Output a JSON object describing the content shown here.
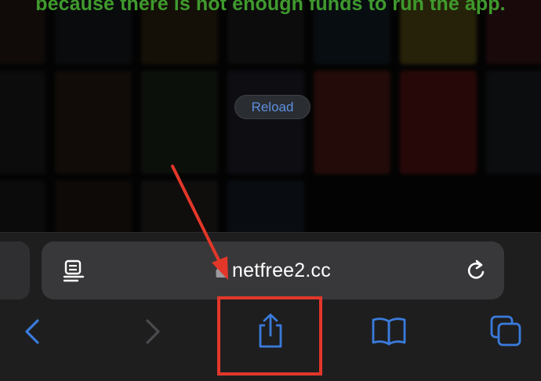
{
  "page": {
    "message": "because there is not enough funds to run the app.",
    "reload_label": "Reload"
  },
  "browser": {
    "url": "netfree2.cc",
    "accent": "#3a7bdc",
    "annotation_color": "#e3372a"
  },
  "icons": {
    "reader": "reader-mode-icon",
    "lock": "lock-icon",
    "refresh": "refresh-icon",
    "back": "chevron-left-icon",
    "forward": "chevron-right-icon",
    "share": "share-icon",
    "bookmarks": "book-icon",
    "tabs": "tabs-icon"
  }
}
